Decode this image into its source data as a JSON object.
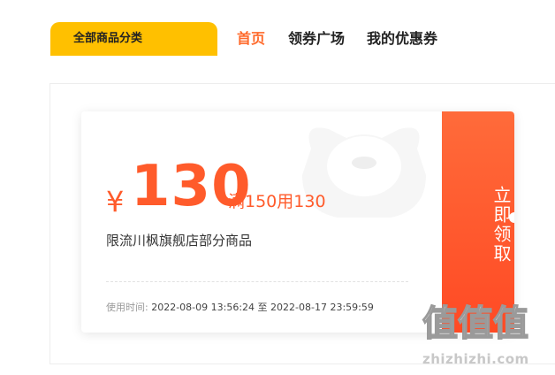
{
  "nav": {
    "category_label": "全部商品分类",
    "links": [
      {
        "label": "首页",
        "active": true
      },
      {
        "label": "领券广场",
        "active": false
      },
      {
        "label": "我的优惠券",
        "active": false
      }
    ]
  },
  "coupon": {
    "currency": "¥",
    "amount": "130",
    "condition": "满150用130",
    "scope": "限流川枫旗舰店部分商品",
    "validity_label": "使用时间:",
    "validity_value": "2022-08-09 13:56:24 至 2022-08-17 23:59:59",
    "claim_label": "立即领取"
  },
  "watermark": {
    "logo_text": "值值值",
    "url": "zhizhizhi.com"
  },
  "colors": {
    "accent": "#ff5b2b",
    "category_bg": "#ffc000",
    "claim_bg": "#ff5a2e"
  }
}
